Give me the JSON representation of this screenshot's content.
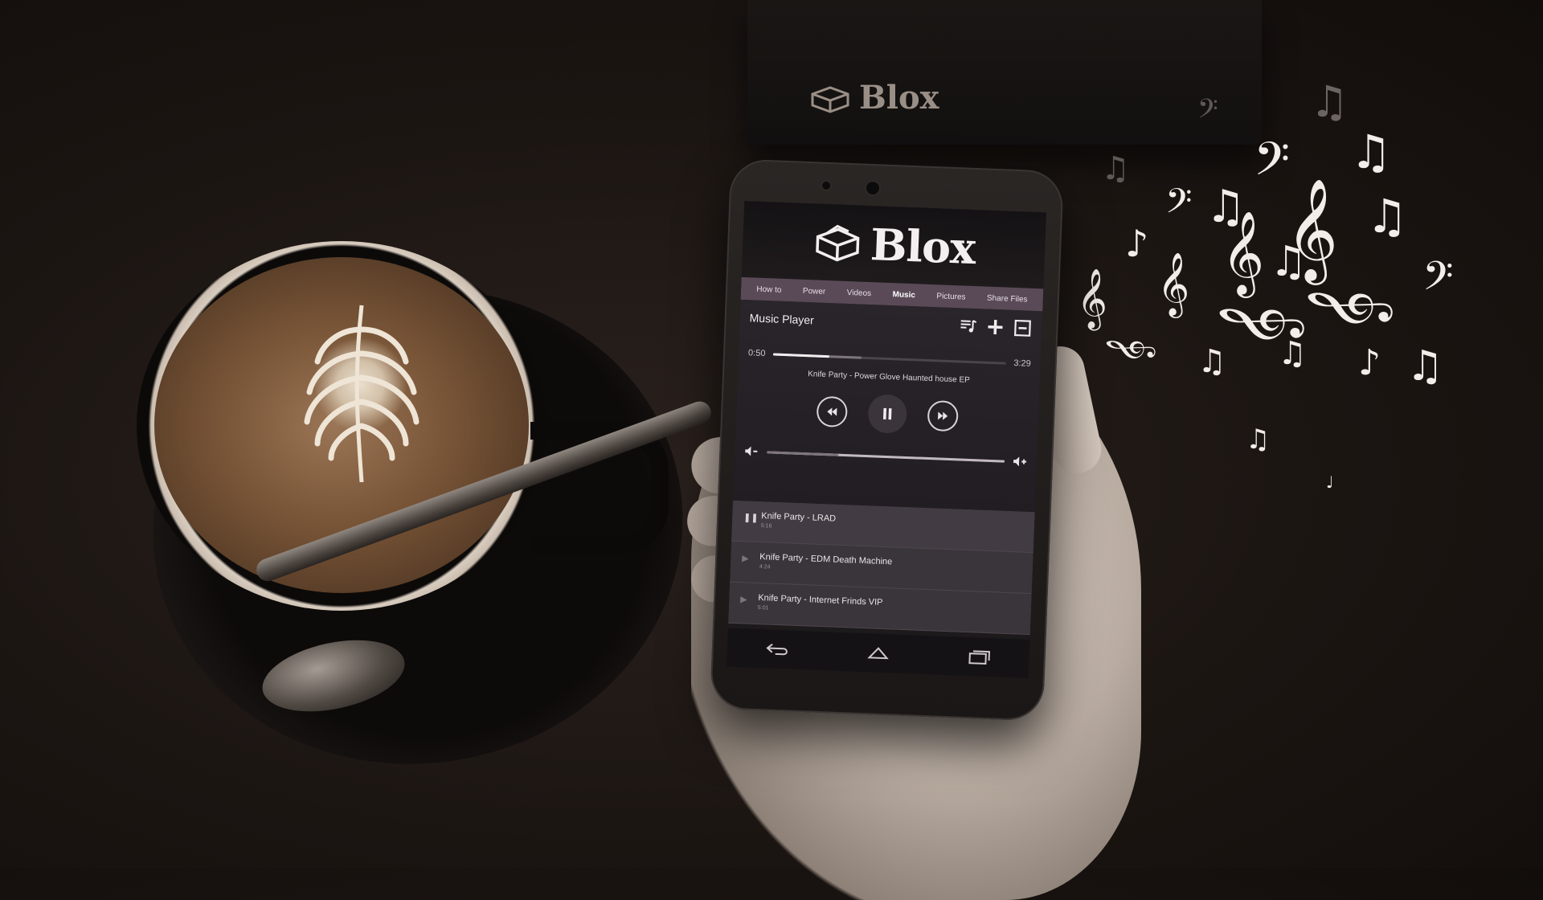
{
  "background": {
    "box_brand": "Blox"
  },
  "app": {
    "brand": "Blox",
    "nav_tabs": [
      {
        "label": "How to",
        "active": false
      },
      {
        "label": "Power",
        "active": false
      },
      {
        "label": "Videos",
        "active": false
      },
      {
        "label": "Music",
        "active": true
      },
      {
        "label": "Pictures",
        "active": false
      },
      {
        "label": "Share Files",
        "active": false
      }
    ],
    "player": {
      "title": "Music Player",
      "elapsed": "0:50",
      "duration": "3:29",
      "progress_fraction": 0.24,
      "now_playing": "Knife Party - Power Glove Haunted house EP",
      "volume_fraction": 0.3
    },
    "playlist": [
      {
        "name": "Knife Party - LRAD",
        "duration": "5:16",
        "state": "playing"
      },
      {
        "name": "Knife Party - EDM Death Machine",
        "duration": "4:24",
        "state": "idle"
      },
      {
        "name": "Knife Party - Internet Frinds VIP",
        "duration": "5:01",
        "state": "idle"
      }
    ],
    "softkeys": [
      "back-icon",
      "home-icon",
      "recents-icon"
    ]
  },
  "colors": {
    "nav_bar": "#5a4a57",
    "screen_bg": "#1d1a1b",
    "accent": "#f1ecee"
  }
}
